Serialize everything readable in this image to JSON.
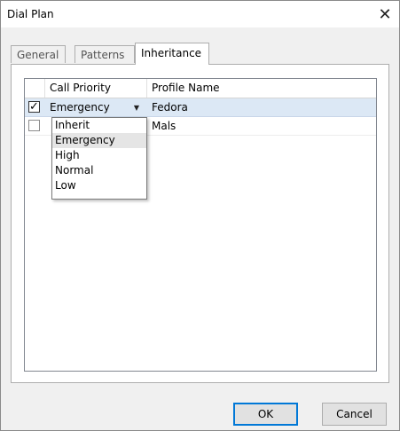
{
  "window": {
    "title": "Dial Plan",
    "close_glyph": "✕"
  },
  "tabs": [
    {
      "label": "General",
      "active": false
    },
    {
      "label": "Patterns",
      "active": false
    },
    {
      "label": "Inheritance",
      "active": true
    }
  ],
  "grid": {
    "columns": [
      "",
      "Call Priority",
      "Profile Name"
    ],
    "rows": [
      {
        "checked": true,
        "check_glyph": "✓",
        "priority": "Emergency",
        "profile": "Fedora",
        "selected": true
      },
      {
        "checked": false,
        "check_glyph": "",
        "priority": "",
        "profile": "Mals",
        "selected": false
      }
    ],
    "dropdown_arrow": "▼"
  },
  "dropdown": {
    "options": [
      "Inherit",
      "Emergency",
      "High",
      "Normal",
      "Low"
    ],
    "highlighted": "Emergency"
  },
  "buttons": {
    "ok": "OK",
    "cancel": "Cancel"
  }
}
